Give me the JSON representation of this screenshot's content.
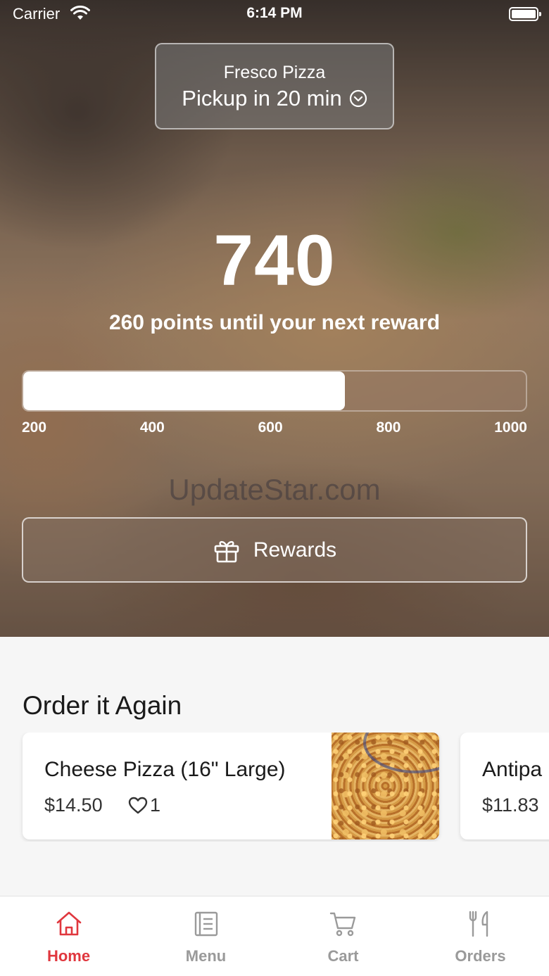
{
  "status_bar": {
    "carrier": "Carrier",
    "time": "6:14 PM"
  },
  "header": {
    "store_name": "Fresco Pizza",
    "pickup": "Pickup in 20 min"
  },
  "rewards": {
    "points": "740",
    "subtitle": "260 points until your next reward",
    "progress_fraction": 0.64,
    "ticks": [
      "200",
      "400",
      "600",
      "800",
      "1000"
    ],
    "button_label": "Rewards"
  },
  "watermark": "UpdateStar.com",
  "order_again": {
    "title": "Order it Again",
    "items": [
      {
        "name": "Cheese Pizza (16\" Large)",
        "price": "$14.50",
        "likes": "1"
      },
      {
        "name": "Antipa",
        "price": "$11.83"
      }
    ]
  },
  "tab_bar": {
    "tabs": [
      {
        "label": "Home",
        "icon": "home-icon",
        "active": true
      },
      {
        "label": "Menu",
        "icon": "menu-icon",
        "active": false
      },
      {
        "label": "Cart",
        "icon": "cart-icon",
        "active": false
      },
      {
        "label": "Orders",
        "icon": "utensils-icon",
        "active": false
      }
    ]
  },
  "colors": {
    "accent": "#e0373e",
    "inactive_tab": "#9a9a9a"
  }
}
